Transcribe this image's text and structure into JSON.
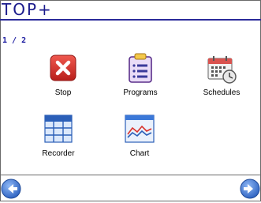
{
  "header": {
    "brand": "TOP+",
    "page_indicator": "1 / 2"
  },
  "tiles": [
    {
      "label": "Stop",
      "icon": "stop-icon"
    },
    {
      "label": "Programs",
      "icon": "clipboard-list-icon"
    },
    {
      "label": "Schedules",
      "icon": "calendar-clock-icon"
    },
    {
      "label": "Recorder",
      "icon": "table-grid-icon"
    },
    {
      "label": "Chart",
      "icon": "line-chart-icon"
    }
  ],
  "nav": {
    "prev_icon": "arrow-left-icon",
    "next_icon": "arrow-right-icon"
  },
  "colors": {
    "brand": "#1a1a8c",
    "stop_red": "#d9312b",
    "nav_blue": "#3b78d8"
  }
}
